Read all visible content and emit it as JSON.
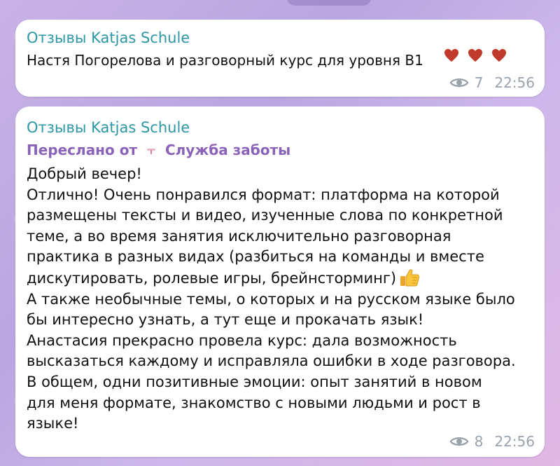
{
  "messages": [
    {
      "sender": "Отзывы Katjas Schule",
      "text": "Настя Погорелова и разговорный курс для уровня В1",
      "reactions": [
        "heart-icon",
        "heart-icon",
        "heart-icon"
      ],
      "views": "7",
      "time": "22:56"
    },
    {
      "sender": "Отзывы Katjas Schule",
      "forwarded_prefix": "Переслано от",
      "forwarded_from": "Служба заботы",
      "lines": [
        "Добрый вечер!",
        "Отлично! Очень понравился формат: платформа на которой",
        "размещены тексты и видео, изученные слова по конкретной",
        "теме, а во время занятия исключительно разговорная",
        "практика в разных видах (разбиться на команды и вместе",
        "дискутировать, ролевые игры, брейнсторминг)",
        "А также необычные темы, о которых и на русском языке было",
        "бы интересно узнать, а тут еще и прокачать язык!",
        "Анастасия прекрасно провела курс: дала возможность",
        "высказаться каждому и исправляла ошибки в ходе разговора.",
        "В общем, одни позитивные эмоции: опыт занятий в новом",
        "для меня формате, знакомство с новыми людьми и рост в",
        "языке!"
      ],
      "emoji_after_line_6": "thumbs-up-icon",
      "views": "8",
      "time": "22:56"
    }
  ],
  "colors": {
    "sender": "#2e97a6",
    "forwarded": "#8a63b8",
    "meta": "#9aa3ad",
    "heart": "#c0392b"
  }
}
